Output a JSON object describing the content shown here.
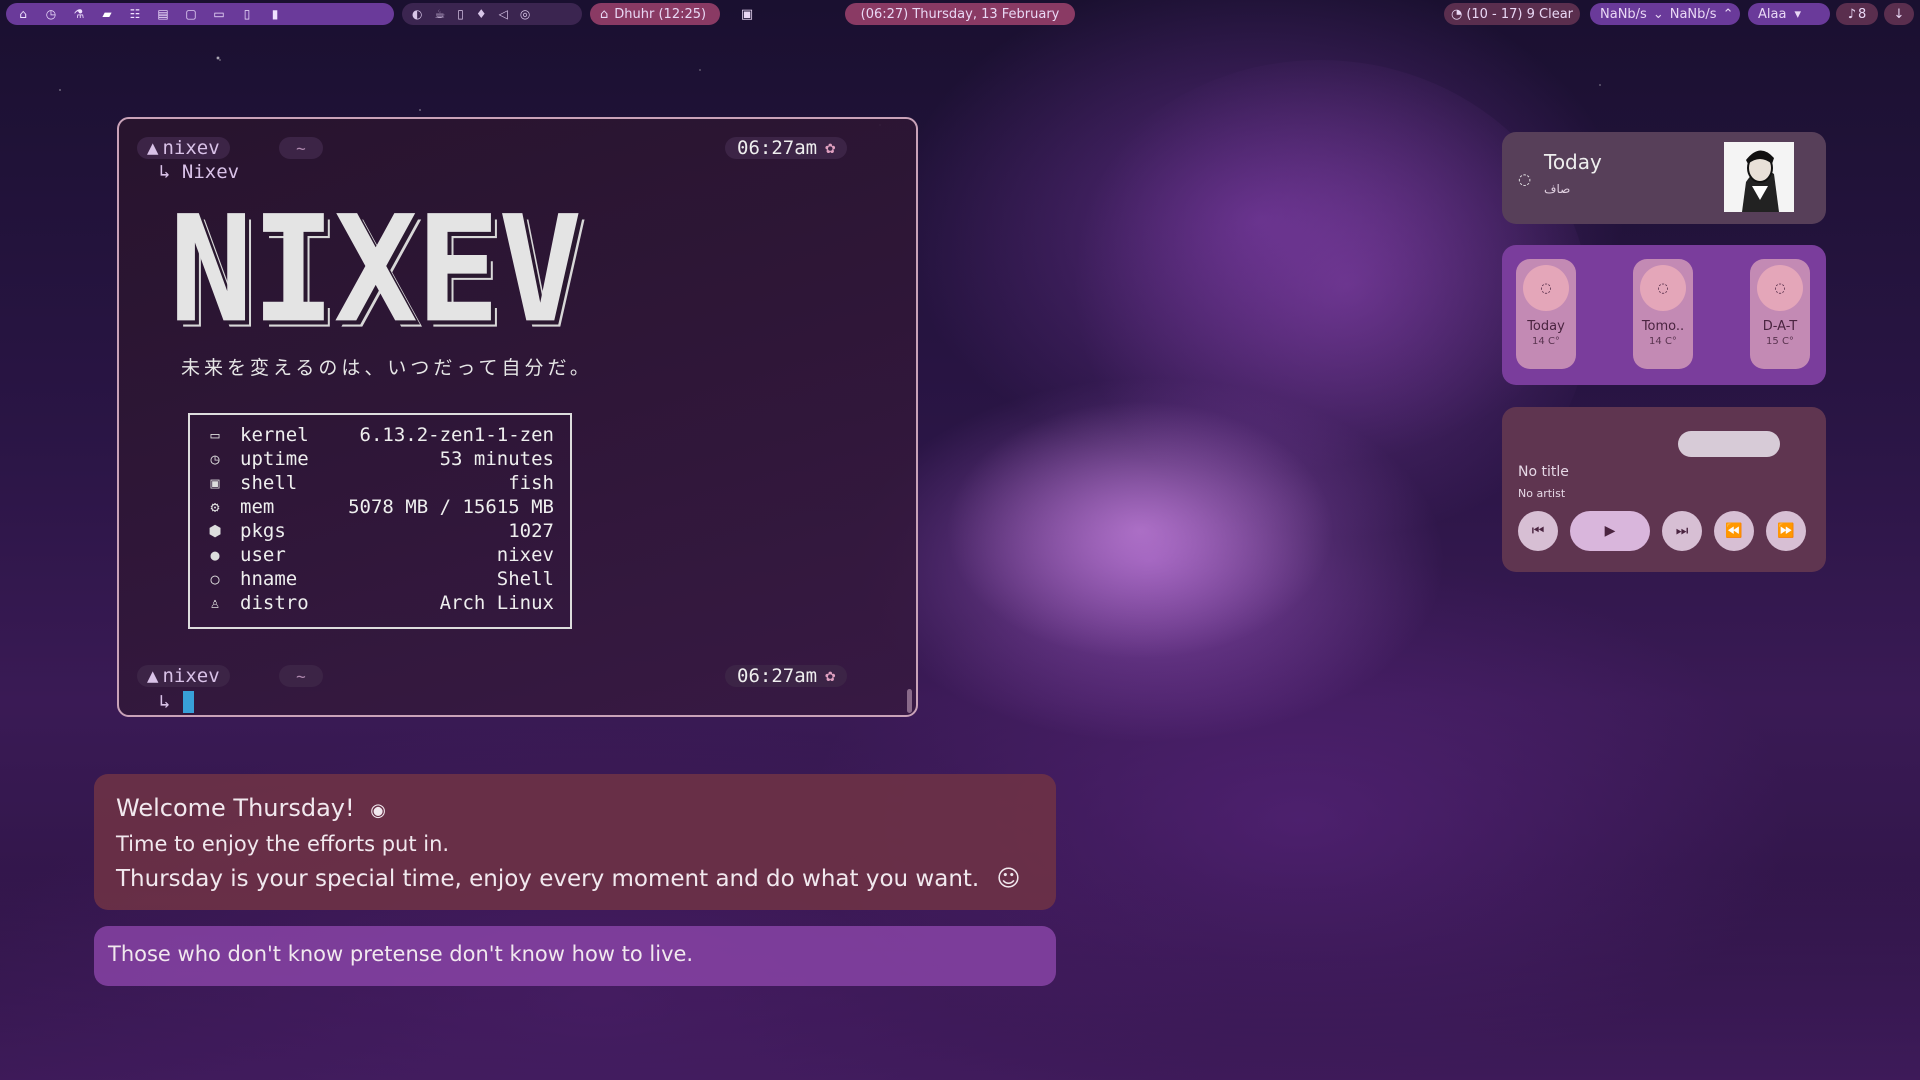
{
  "topbar": {
    "prayer": "Dhuhr (12:25)",
    "clock": "(06:27) Thursday, 13 February",
    "weather": "(10 - 17) 9 Clear",
    "net_down": "NaNb/s",
    "net_up": "NaNb/s",
    "wifi_name": "Alaa",
    "notif_count": "8"
  },
  "terminal": {
    "user": "nixev",
    "dir": "~",
    "subtitle": "Nixev",
    "time_top": "06:27am",
    "time_bottom": "06:27am",
    "banner": "NIXEV",
    "motto": "未来を変えるのは、いつだって自分だ。",
    "info": [
      {
        "icon": "laptop-icon",
        "glyph": "▭",
        "label": "kernel",
        "value": "6.13.2-zen1-1-zen"
      },
      {
        "icon": "clock-icon",
        "glyph": "◷",
        "label": "uptime",
        "value": "53 minutes"
      },
      {
        "icon": "terminal-icon",
        "glyph": "▣",
        "label": "shell",
        "value": "fish"
      },
      {
        "icon": "memory-icon",
        "glyph": "⚙",
        "label": "mem",
        "value": "5078 MB / 15615 MB"
      },
      {
        "icon": "package-icon",
        "glyph": "⬢",
        "label": "pkgs",
        "value": "1027"
      },
      {
        "icon": "user-icon",
        "glyph": "●",
        "label": "user",
        "value": "nixev"
      },
      {
        "icon": "host-icon",
        "glyph": "○",
        "label": "hname",
        "value": "Shell"
      },
      {
        "icon": "linux-icon",
        "glyph": "♙",
        "label": "distro",
        "value": "Arch Linux"
      }
    ]
  },
  "widgets": {
    "today": {
      "title": "Today",
      "subtitle": "صاف"
    },
    "forecast": [
      {
        "name": "Today",
        "temp": "14 C°"
      },
      {
        "name": "Tomo..",
        "temp": "14 C°"
      },
      {
        "name": "D-A-T",
        "temp": "15 C°"
      }
    ],
    "media": {
      "title": "No title",
      "artist": "No artist"
    }
  },
  "welcome": {
    "line1": "Welcome Thursday!",
    "line2": "Time to enjoy the efforts put in.",
    "line3": "Thursday is your special time, enjoy every moment and do what you want."
  },
  "quote": "Those who don't know pretense don't know how to live.",
  "colors": {
    "accent": "#7a3d9c",
    "bar_pill": "#8a3a64",
    "terminal_border": "#c9a2b8",
    "cursor": "#38a0d8"
  }
}
